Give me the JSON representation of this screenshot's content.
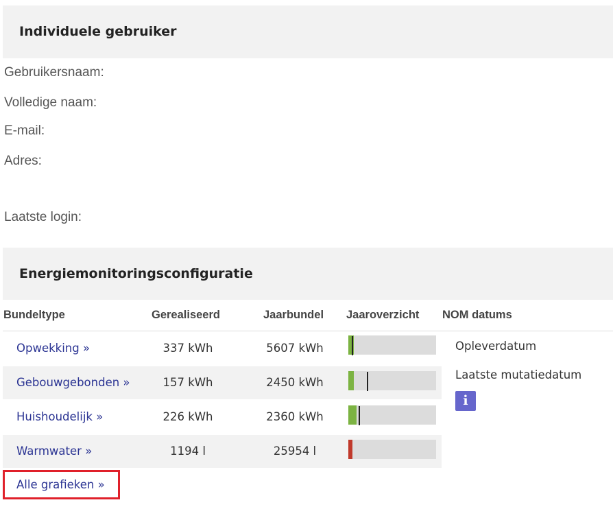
{
  "user_section": {
    "title": "Individuele gebruiker",
    "fields": {
      "username": "Gebruikersnaam:",
      "fullname": "Volledige naam:",
      "email": "E-mail:",
      "address": "Adres:",
      "last_login": "Laatste login:"
    }
  },
  "energy_section": {
    "title": "Energiemonitoringsconfiguratie",
    "columns": {
      "type": "Bundeltype",
      "realized": "Gerealiseerd",
      "yearbundle": "Jaarbundel",
      "overview": "Jaaroverzicht",
      "nom": "NOM datums"
    },
    "rows": [
      {
        "type": "Opwekking »",
        "realized": "337 kWh",
        "yearbundle": "5607 kWh",
        "usage_fraction": 0.06,
        "year_progress_fraction": 0.04,
        "bar_color": "#7cb342"
      },
      {
        "type": "Gebouwgebonden »",
        "realized": "157 kWh",
        "yearbundle": "2450 kWh",
        "usage_fraction": 0.064,
        "year_progress_fraction": 0.21,
        "bar_color": "#7cb342"
      },
      {
        "type": "Huishoudelijk »",
        "realized": "226 kWh",
        "yearbundle": "2360 kWh",
        "usage_fraction": 0.096,
        "year_progress_fraction": 0.12,
        "bar_color": "#7cb342"
      },
      {
        "type": "Warmwater »",
        "realized": "1194 l",
        "yearbundle": "25954 l",
        "usage_fraction": 0.046,
        "year_progress_fraction": null,
        "bar_color": "#c0392b"
      }
    ],
    "nom": {
      "delivery_date": "Opleverdatum",
      "last_mutation_date": "Laatste mutatiedatum",
      "info_icon": "info-icon",
      "info_glyph": "i"
    },
    "all_graphs": "Alle grafieken »"
  },
  "colors": {
    "link": "#2b3493",
    "panel_bg": "#f2f2f2",
    "info_button": "#6666cc",
    "highlight_border": "#e0202a"
  }
}
